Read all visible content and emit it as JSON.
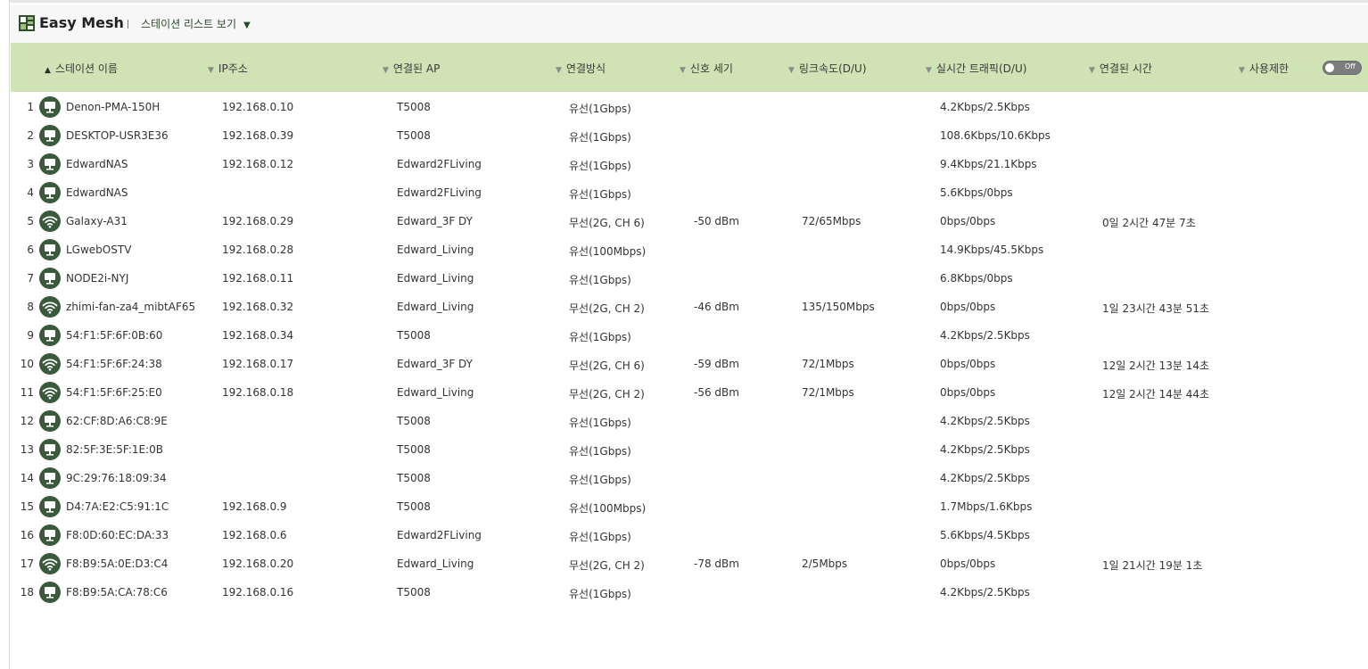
{
  "app": {
    "title": "Easy Mesh",
    "view_label": "스테이션 리스트 보기",
    "view_caret": "▼"
  },
  "colors": {
    "header_bg": "#cfe3b5",
    "icon_bg": "#3b5a3b",
    "toggle_off": "#7d7d7d"
  },
  "table": {
    "columns": [
      {
        "label": "스테이션 이름",
        "sort_arrow": "▲",
        "active": true
      },
      {
        "label": "IP주소",
        "sort_arrow": "▼",
        "active": false
      },
      {
        "label": "연결된 AP",
        "sort_arrow": "▼",
        "active": false
      },
      {
        "label": "연결방식",
        "sort_arrow": "▼",
        "active": false
      },
      {
        "label": "신호 세기",
        "sort_arrow": "▼",
        "active": false
      },
      {
        "label": "링크속도(D/U)",
        "sort_arrow": "▼",
        "active": false
      },
      {
        "label": "실시간 트래픽(D/U)",
        "sort_arrow": "▼",
        "active": false
      },
      {
        "label": "연결된 시간",
        "sort_arrow": "▼",
        "active": false
      },
      {
        "label": "사용제한",
        "sort_arrow": "▼",
        "active": false
      }
    ],
    "limit_toggle": {
      "label": "Off",
      "state": "off"
    },
    "rows": [
      {
        "num": "1",
        "icon": "wired-device-icon",
        "name": "Denon-PMA-150H",
        "ip": "192.168.0.10",
        "ap": "T5008",
        "conn": "유선(1Gbps)",
        "signal": "",
        "link": "",
        "traffic": "4.2Kbps/2.5Kbps",
        "time": ""
      },
      {
        "num": "2",
        "icon": "wired-device-icon",
        "name": "DESKTOP-USR3E36",
        "ip": "192.168.0.39",
        "ap": "T5008",
        "conn": "유선(1Gbps)",
        "signal": "",
        "link": "",
        "traffic": "108.6Kbps/10.6Kbps",
        "time": ""
      },
      {
        "num": "3",
        "icon": "wired-device-icon",
        "name": "EdwardNAS",
        "ip": "192.168.0.12",
        "ap": "Edward2FLiving",
        "conn": "유선(1Gbps)",
        "signal": "",
        "link": "",
        "traffic": "9.4Kbps/21.1Kbps",
        "time": ""
      },
      {
        "num": "4",
        "icon": "wired-device-icon",
        "name": "EdwardNAS",
        "ip": "",
        "ap": "Edward2FLiving",
        "conn": "유선(1Gbps)",
        "signal": "",
        "link": "",
        "traffic": "5.6Kbps/0bps",
        "time": ""
      },
      {
        "num": "5",
        "icon": "wifi-icon",
        "name": "Galaxy-A31",
        "ip": "192.168.0.29",
        "ap": "Edward_3F DY",
        "conn": "무선(2G, CH 6)",
        "signal": "-50 dBm",
        "link": "72/65Mbps",
        "traffic": "0bps/0bps",
        "time": "0일 2시간 47분 7초"
      },
      {
        "num": "6",
        "icon": "wired-device-icon",
        "name": "LGwebOSTV",
        "ip": "192.168.0.28",
        "ap": "Edward_Living",
        "conn": "유선(100Mbps)",
        "signal": "",
        "link": "",
        "traffic": "14.9Kbps/45.5Kbps",
        "time": ""
      },
      {
        "num": "7",
        "icon": "wired-device-icon",
        "name": "NODE2i-NYJ",
        "ip": "192.168.0.11",
        "ap": "Edward_Living",
        "conn": "유선(1Gbps)",
        "signal": "",
        "link": "",
        "traffic": "6.8Kbps/0bps",
        "time": ""
      },
      {
        "num": "8",
        "icon": "wifi-icon",
        "name": "zhimi-fan-za4_mibtAF65",
        "ip": "192.168.0.32",
        "ap": "Edward_Living",
        "conn": "무선(2G, CH 2)",
        "signal": "-46 dBm",
        "link": "135/150Mbps",
        "traffic": "0bps/0bps",
        "time": "1일 23시간 43분 51초"
      },
      {
        "num": "9",
        "icon": "wired-device-icon",
        "name": "54:F1:5F:6F:0B:60",
        "ip": "192.168.0.34",
        "ap": "T5008",
        "conn": "유선(1Gbps)",
        "signal": "",
        "link": "",
        "traffic": "4.2Kbps/2.5Kbps",
        "time": ""
      },
      {
        "num": "10",
        "icon": "wifi-icon",
        "name": "54:F1:5F:6F:24:38",
        "ip": "192.168.0.17",
        "ap": "Edward_3F DY",
        "conn": "무선(2G, CH 6)",
        "signal": "-59 dBm",
        "link": "72/1Mbps",
        "traffic": "0bps/0bps",
        "time": "12일 2시간 13분 14초"
      },
      {
        "num": "11",
        "icon": "wifi-icon",
        "name": "54:F1:5F:6F:25:E0",
        "ip": "192.168.0.18",
        "ap": "Edward_Living",
        "conn": "무선(2G, CH 2)",
        "signal": "-56 dBm",
        "link": "72/1Mbps",
        "traffic": "0bps/0bps",
        "time": "12일 2시간 14분 44초"
      },
      {
        "num": "12",
        "icon": "wired-device-icon",
        "name": "62:CF:8D:A6:C8:9E",
        "ip": "",
        "ap": "T5008",
        "conn": "유선(1Gbps)",
        "signal": "",
        "link": "",
        "traffic": "4.2Kbps/2.5Kbps",
        "time": ""
      },
      {
        "num": "13",
        "icon": "wired-device-icon",
        "name": "82:5F:3E:5F:1E:0B",
        "ip": "",
        "ap": "T5008",
        "conn": "유선(1Gbps)",
        "signal": "",
        "link": "",
        "traffic": "4.2Kbps/2.5Kbps",
        "time": ""
      },
      {
        "num": "14",
        "icon": "wired-device-icon",
        "name": "9C:29:76:18:09:34",
        "ip": "",
        "ap": "T5008",
        "conn": "유선(1Gbps)",
        "signal": "",
        "link": "",
        "traffic": "4.2Kbps/2.5Kbps",
        "time": ""
      },
      {
        "num": "15",
        "icon": "wired-device-icon",
        "name": "D4:7A:E2:C5:91:1C",
        "ip": "192.168.0.9",
        "ap": "T5008",
        "conn": "유선(100Mbps)",
        "signal": "",
        "link": "",
        "traffic": "1.7Mbps/1.6Kbps",
        "time": ""
      },
      {
        "num": "16",
        "icon": "wired-device-icon",
        "name": "F8:0D:60:EC:DA:33",
        "ip": "192.168.0.6",
        "ap": "Edward2FLiving",
        "conn": "유선(1Gbps)",
        "signal": "",
        "link": "",
        "traffic": "5.6Kbps/4.5Kbps",
        "time": ""
      },
      {
        "num": "17",
        "icon": "wifi-icon",
        "name": "F8:B9:5A:0E:D3:C4",
        "ip": "192.168.0.20",
        "ap": "Edward_Living",
        "conn": "무선(2G, CH 2)",
        "signal": "-78 dBm",
        "link": "2/5Mbps",
        "traffic": "0bps/0bps",
        "time": "1일 21시간 19분 1초"
      },
      {
        "num": "18",
        "icon": "wired-device-icon",
        "name": "F8:B9:5A:CA:78:C6",
        "ip": "192.168.0.16",
        "ap": "T5008",
        "conn": "유선(1Gbps)",
        "signal": "",
        "link": "",
        "traffic": "4.2Kbps/2.5Kbps",
        "time": ""
      }
    ]
  }
}
